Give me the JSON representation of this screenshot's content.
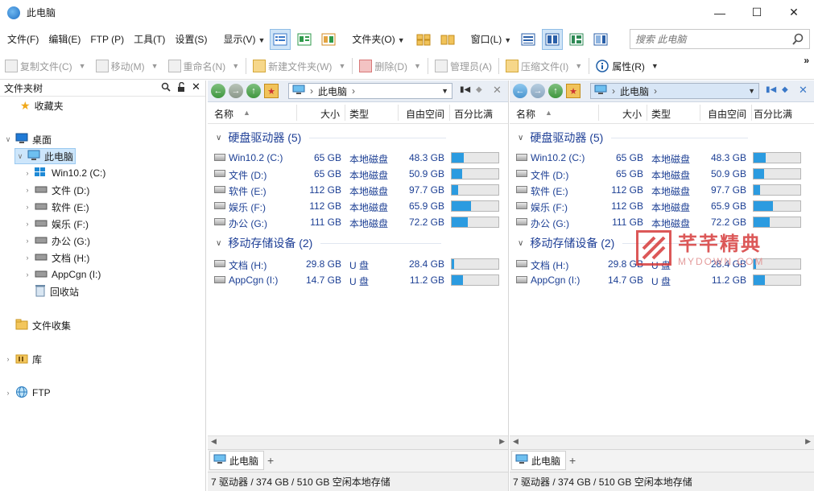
{
  "window": {
    "title": "此电脑"
  },
  "menu": {
    "file": "文件(F)",
    "edit": "编辑(E)",
    "ftp": "FTP (P)",
    "tools": "工具(T)",
    "settings": "设置(S)",
    "view": "显示(V)",
    "folders": "文件夹(O)",
    "windows": "窗口(L)"
  },
  "search": {
    "placeholder": "搜索 此电脑"
  },
  "actions": {
    "copy": "复制文件(C)",
    "move": "移动(M)",
    "rename": "重命名(N)",
    "newfolder": "新建文件夹(W)",
    "delete": "删除(D)",
    "admin": "管理员(A)",
    "compress": "压缩文件(I)",
    "properties": "属性(R)"
  },
  "tree": {
    "header": "文件夹树",
    "favorites": "收藏夹",
    "desktop": "桌面",
    "thispc": "此电脑",
    "drives": [
      "Win10.2 (C:)",
      "文件 (D:)",
      "软件 (E:)",
      "娱乐 (F:)",
      "办公 (G:)",
      "文档 (H:)",
      "AppCgn (I:)"
    ],
    "recycle": "回收站",
    "collection": "文件收集",
    "library": "库",
    "ftp": "FTP"
  },
  "pane": {
    "address": "此电脑",
    "columns": {
      "name": "名称",
      "size": "大小",
      "type": "类型",
      "free": "自由空间",
      "percent": "百分比满"
    },
    "groups": {
      "hdd": "硬盘驱动器 (5)",
      "removable": "移动存储设备 (2)"
    },
    "hdd": [
      {
        "name": "Win10.2 (C:)",
        "size": "65 GB",
        "type": "本地磁盘",
        "free": "48.3 GB",
        "pct": 0.26
      },
      {
        "name": "文件 (D:)",
        "size": "65 GB",
        "type": "本地磁盘",
        "free": "50.9 GB",
        "pct": 0.22
      },
      {
        "name": "软件 (E:)",
        "size": "112 GB",
        "type": "本地磁盘",
        "free": "97.7 GB",
        "pct": 0.13
      },
      {
        "name": "娱乐 (F:)",
        "size": "112 GB",
        "type": "本地磁盘",
        "free": "65.9 GB",
        "pct": 0.41
      },
      {
        "name": "办公 (G:)",
        "size": "111 GB",
        "type": "本地磁盘",
        "free": "72.2 GB",
        "pct": 0.35
      }
    ],
    "removable": [
      {
        "name": "文档 (H:)",
        "size": "29.8 GB",
        "type": "U 盘",
        "free": "28.4 GB",
        "pct": 0.05
      },
      {
        "name": "AppCgn (I:)",
        "size": "14.7 GB",
        "type": "U 盘",
        "free": "11.2 GB",
        "pct": 0.24
      }
    ],
    "tab": "此电脑",
    "status": "7 驱动器 / 374 GB / 510 GB 空闲本地存储"
  },
  "watermark": {
    "title": "芊芊精典",
    "sub": "MYDOWN.COM"
  },
  "colors": {
    "accent": "#2b9be0",
    "link": "#1c3f94",
    "selected": "#cde6fb"
  }
}
